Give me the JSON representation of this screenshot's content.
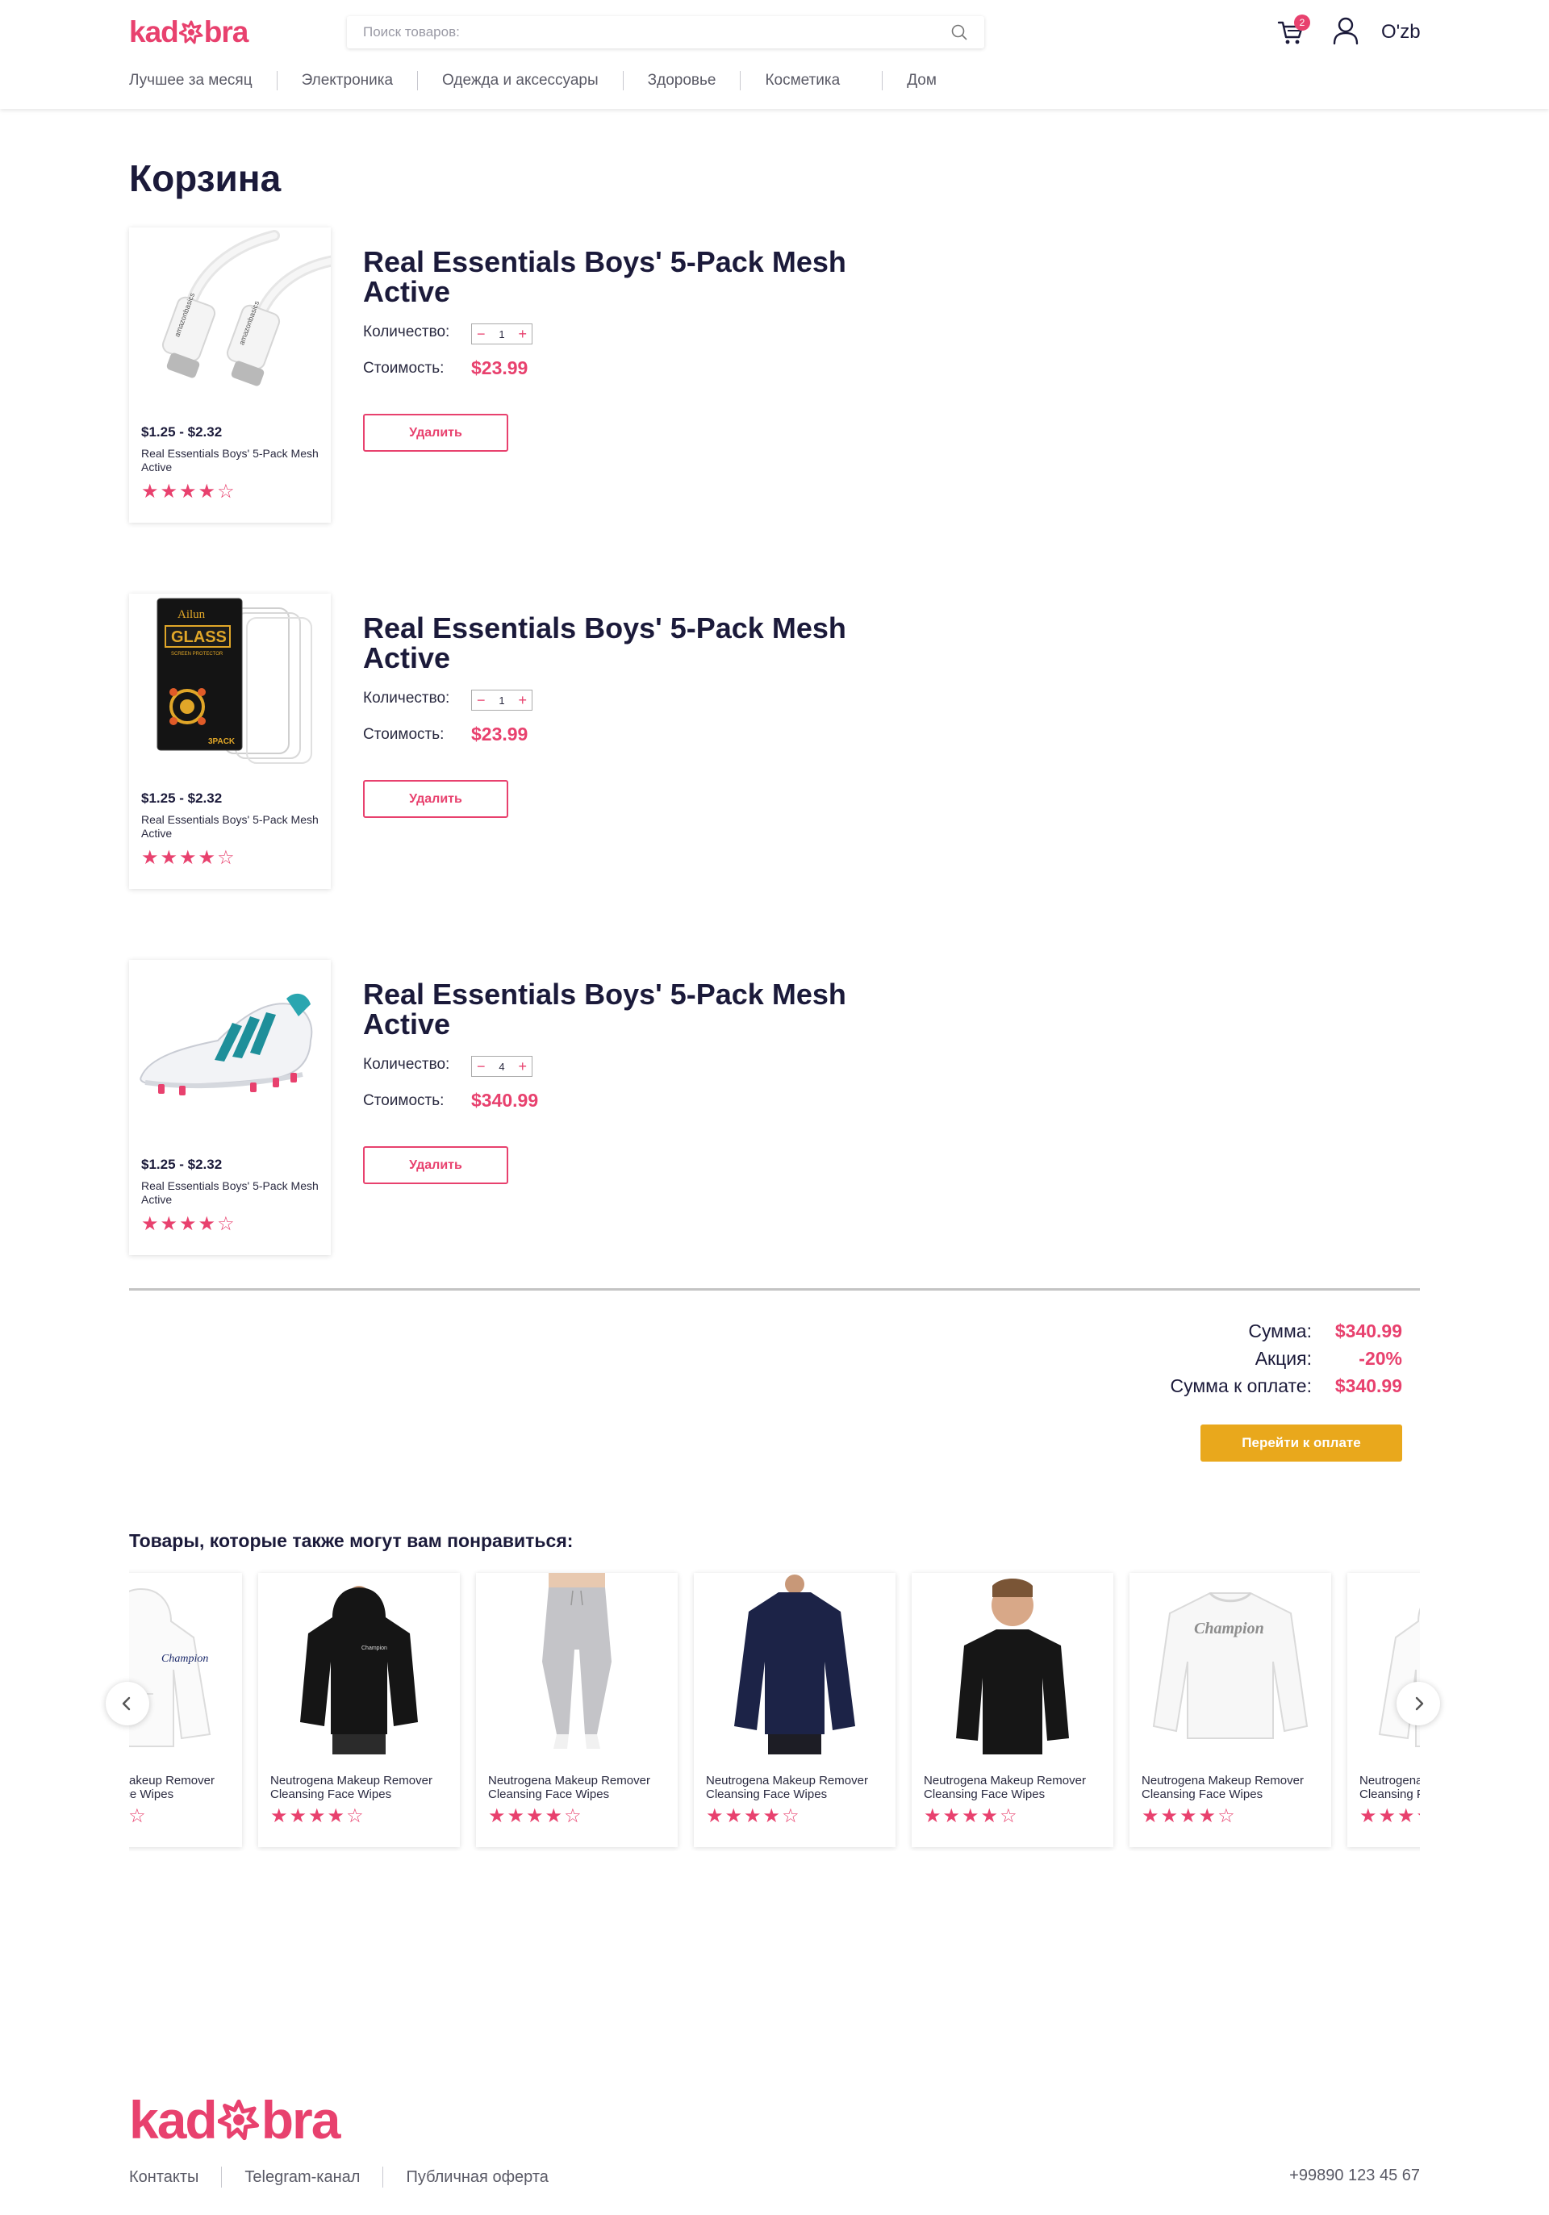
{
  "header": {
    "logo_left": "kad",
    "logo_right": "bra",
    "search_placeholder": "Поиск товаров:",
    "cart_count": "2",
    "language": "O'zb",
    "nav": [
      "Лучшее за месяц",
      "Электроника",
      "Одежда и аксессуары",
      "Здоровье",
      "Косметика",
      "Дом"
    ]
  },
  "page": {
    "title": "Корзина"
  },
  "cart": {
    "quantity_label": "Количество:",
    "cost_label": "Стоимость:",
    "delete_label": "Удалить",
    "minus": "−",
    "plus": "+",
    "items": [
      {
        "title": "Real Essentials Boys' 5-Pack Mesh Active",
        "quantity": "1",
        "cost": "$23.99",
        "card_price": "$1.25 - $2.32",
        "card_name": "Real Essentials Boys' 5-Pack Mesh Active",
        "rating": 4,
        "image": "usb-cables"
      },
      {
        "title": "Real Essentials Boys' 5-Pack Mesh Active",
        "quantity": "1",
        "cost": "$23.99",
        "card_price": "$1.25 - $2.32",
        "card_name": "Real Essentials Boys' 5-Pack Mesh Active",
        "rating": 4,
        "image": "screen-protector"
      },
      {
        "title": "Real Essentials Boys' 5-Pack Mesh Active",
        "quantity": "4",
        "cost": "$340.99",
        "card_price": "$1.25 - $2.32",
        "card_name": "Real Essentials Boys' 5-Pack Mesh Active",
        "rating": 4,
        "image": "football-boot"
      }
    ]
  },
  "summary": {
    "sum_label": "Сумма:",
    "sum_value": "$340.99",
    "promo_label": "Акция:",
    "promo_value": "-20%",
    "total_label": "Сумма к оплате:",
    "total_value": "$340.99",
    "pay_button": "Перейти к оплате"
  },
  "recommendations": {
    "title": "Товары, которые также могут вам понравиться:",
    "items": [
      {
        "name": "Neutrogena Makeup Remover Cleansing Face Wipes",
        "rating": 4,
        "image": "white-hoodie"
      },
      {
        "name": "Neutrogena Makeup Remover Cleansing Face Wipes",
        "rating": 4,
        "image": "black-hoodie"
      },
      {
        "name": "Neutrogena Makeup Remover Cleansing Face Wipes",
        "rating": 4,
        "image": "grey-joggers"
      },
      {
        "name": "Neutrogena Makeup Remover Cleansing Face Wipes",
        "rating": 4,
        "image": "navy-sweatshirt"
      },
      {
        "name": "Neutrogena Makeup Remover Cleansing Face Wipes",
        "rating": 4,
        "image": "black-longsleeve"
      },
      {
        "name": "Neutrogena Makeup Remover Cleansing Face Wipes",
        "rating": 4,
        "image": "white-champion-sweatshirt"
      },
      {
        "name": "Neutrogena Makeup Remover Cleansing Face Wipes",
        "rating": 4,
        "image": "white-hoodie"
      }
    ]
  },
  "footer": {
    "logo_left": "kad",
    "logo_right": "bra",
    "links": [
      "Контакты",
      "Telegram-канал",
      "Публичная оферта"
    ],
    "phone": "+99890 123 45 67"
  },
  "colors": {
    "accent": "#e8416e",
    "pay": "#e9a81c",
    "text": "#1b1a3a"
  }
}
